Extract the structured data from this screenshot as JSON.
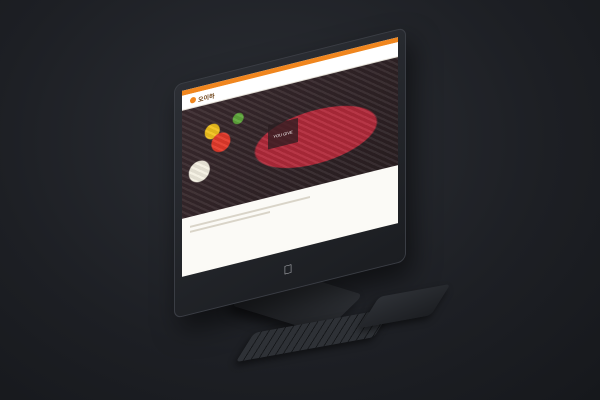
{
  "site": {
    "brand": "오이하",
    "nav": [
      "",
      "",
      "",
      ""
    ],
    "hero_badge": "YOU GIVE",
    "footer": ""
  },
  "icons": {
    "apple": "apple-logo-icon"
  },
  "colors": {
    "accent": "#f0861e",
    "background": "#1d1f24",
    "screen_bg": "#fbfaf6"
  }
}
